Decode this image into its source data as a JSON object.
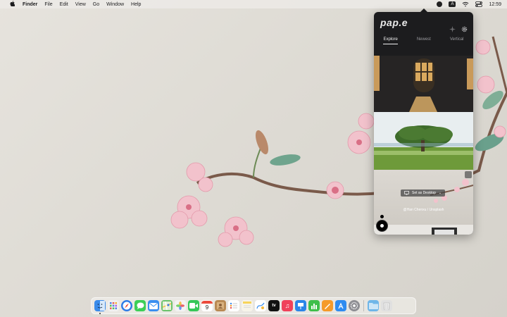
{
  "menubar": {
    "apple_icon": "apple-logo-icon",
    "app_name": "Finder",
    "items": [
      "File",
      "Edit",
      "View",
      "Go",
      "Window",
      "Help"
    ],
    "status": {
      "input_badge": "A",
      "clock": "12:59"
    }
  },
  "panel": {
    "logo": "pap.e",
    "tabs": [
      "Explore",
      "Newest",
      "Vertical"
    ],
    "active_tab": "Explore",
    "set_desktop_label": "Set as Desktop",
    "photo_credit": "@Han Chenxu / Unsplash"
  },
  "dock": {
    "apps": [
      {
        "name": "Finder",
        "color": "#3b8bea",
        "icon": "finder-icon",
        "running": true
      },
      {
        "name": "Launchpad",
        "color": "#f0f0f0",
        "icon": "launchpad-icon"
      },
      {
        "name": "Safari",
        "color": "#2e7be6",
        "icon": "safari-icon"
      },
      {
        "name": "Messages",
        "color": "#3ccf57",
        "icon": "messages-icon"
      },
      {
        "name": "Mail",
        "color": "#3a8ff0",
        "icon": "mail-icon"
      },
      {
        "name": "Maps",
        "color": "#6ac26b",
        "icon": "maps-icon"
      },
      {
        "name": "Photos",
        "color": "#f3f3f3",
        "icon": "photos-icon"
      },
      {
        "name": "FaceTime",
        "color": "#36c758",
        "icon": "facetime-icon"
      },
      {
        "name": "Calendar",
        "color": "#ffffff",
        "icon": "calendar-icon",
        "day": "9"
      },
      {
        "name": "Contacts",
        "color": "#b98a53",
        "icon": "contacts-icon"
      },
      {
        "name": "Reminders",
        "color": "#ffffff",
        "icon": "reminders-icon"
      },
      {
        "name": "Notes",
        "color": "#f7d45a",
        "icon": "notes-icon"
      },
      {
        "name": "Freeform",
        "color": "#ffffff",
        "icon": "freeform-icon"
      },
      {
        "name": "TV",
        "color": "#111111",
        "icon": "tv-icon"
      },
      {
        "name": "Music",
        "color": "#f0425a",
        "icon": "music-icon"
      },
      {
        "name": "Keynote",
        "color": "#2b86e8",
        "icon": "keynote-icon"
      },
      {
        "name": "Numbers",
        "color": "#3fbf4b",
        "icon": "numbers-icon"
      },
      {
        "name": "Pages",
        "color": "#f59a2a",
        "icon": "pages-icon"
      },
      {
        "name": "App Store",
        "color": "#2f8cf0",
        "icon": "app-store-icon"
      },
      {
        "name": "System Settings",
        "color": "#8e8e93",
        "icon": "settings-icon"
      }
    ],
    "folders": [
      {
        "name": "Downloads",
        "color": "#6fb6e8",
        "icon": "folder-icon"
      },
      {
        "name": "Trash",
        "color": "#e0e0e0",
        "icon": "trash-icon"
      }
    ]
  }
}
